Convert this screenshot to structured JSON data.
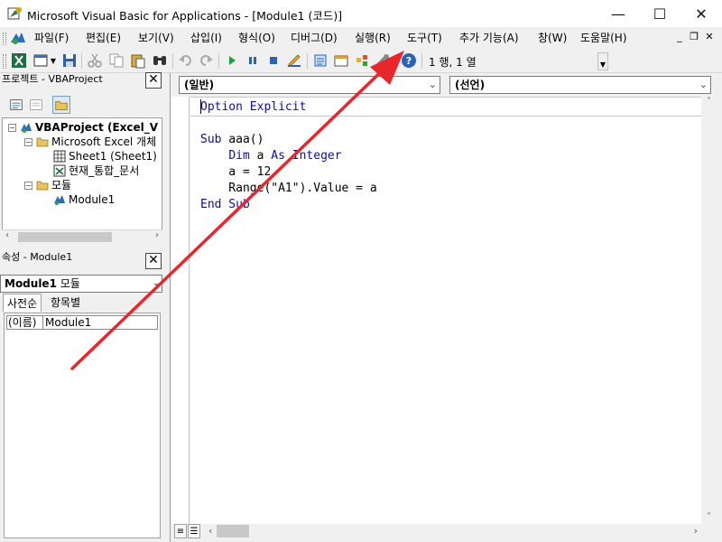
{
  "window": {
    "title": "Microsoft Visual Basic for Applications - [Module1 (코드)]",
    "minimize": "—",
    "maximize": "☐",
    "close": "✕"
  },
  "menu": {
    "items": [
      "파일(F)",
      "편집(E)",
      "보기(V)",
      "삽입(I)",
      "형식(O)",
      "디버그(D)",
      "실행(R)",
      "도구(T)",
      "추가 기능(A)",
      "창(W)",
      "도움말(H)"
    ],
    "mdi_min": "_",
    "mdi_restore": "❐",
    "mdi_close": "✕"
  },
  "toolbar": {
    "cursor_position": "1 행, 1 열"
  },
  "project_pane": {
    "title": "프로젝트 - VBAProject",
    "close": "✕",
    "tree": [
      {
        "label": "VBAProject (Excel_V",
        "bold": true
      },
      {
        "label": "Microsoft Excel 개체"
      },
      {
        "label": "Sheet1 (Sheet1)"
      },
      {
        "label": "현재_통합_문서"
      },
      {
        "label": "모듈"
      },
      {
        "label": "Module1"
      }
    ]
  },
  "properties_pane": {
    "title": "속성 - Module1",
    "close": "✕",
    "object_name": "Module1",
    "object_type": "모듈",
    "tabs": [
      "사전순",
      "항목별"
    ],
    "rows": [
      {
        "key": "(이름)",
        "value": "Module1"
      }
    ]
  },
  "code_window": {
    "object_combo": "(일반)",
    "proc_combo": "(선언)",
    "lines": [
      {
        "segments": [
          {
            "t": "Option Explicit",
            "kw": true
          }
        ]
      },
      {
        "segments": [
          {
            "t": "",
            "kw": false
          }
        ]
      },
      {
        "segments": [
          {
            "t": "Sub",
            "kw": true
          },
          {
            "t": " aaa()",
            "kw": false
          }
        ]
      },
      {
        "segments": [
          {
            "t": "    ",
            "kw": false
          },
          {
            "t": "Dim",
            "kw": true
          },
          {
            "t": " a ",
            "kw": false
          },
          {
            "t": "As Integer",
            "kw": true
          }
        ]
      },
      {
        "segments": [
          {
            "t": "    a = 12",
            "kw": false
          }
        ]
      },
      {
        "segments": [
          {
            "t": "    Range(\"A1\").Value = a",
            "kw": false
          }
        ]
      },
      {
        "segments": [
          {
            "t": "End Sub",
            "kw": true
          }
        ]
      }
    ]
  },
  "colors": {
    "keyword": "#0a0ab0",
    "annotation_arrow": "#e8262c"
  }
}
